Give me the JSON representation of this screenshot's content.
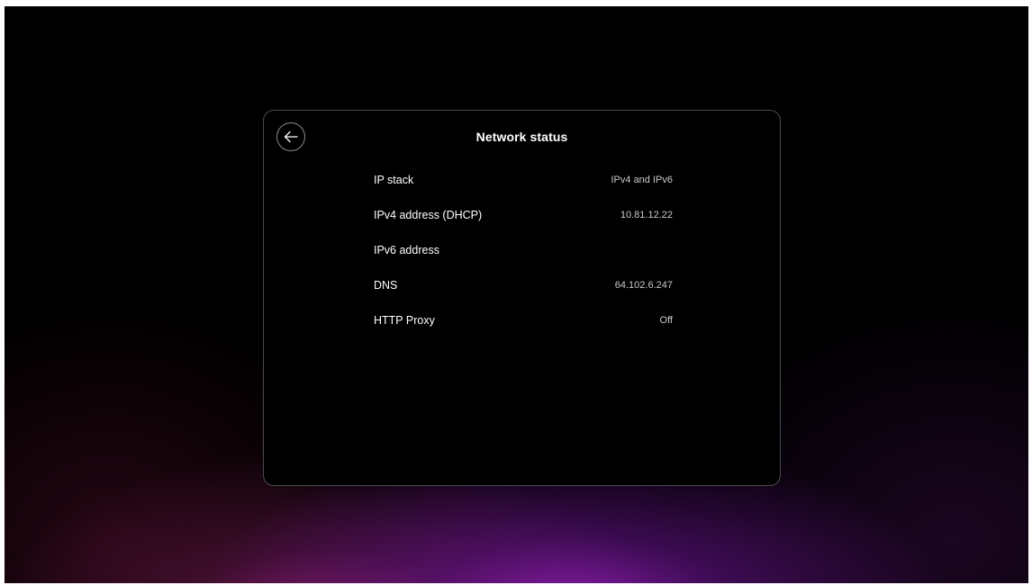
{
  "panel": {
    "title": "Network status",
    "back_icon": "arrow-left-icon"
  },
  "rows": [
    {
      "label": "IP stack",
      "value": "IPv4 and IPv6"
    },
    {
      "label": "IPv4 address (DHCP)",
      "value": "10.81.12.22"
    },
    {
      "label": "IPv6 address",
      "value": ""
    },
    {
      "label": "DNS",
      "value": "64.102.6.247"
    },
    {
      "label": "HTTP Proxy",
      "value": "Off"
    }
  ]
}
